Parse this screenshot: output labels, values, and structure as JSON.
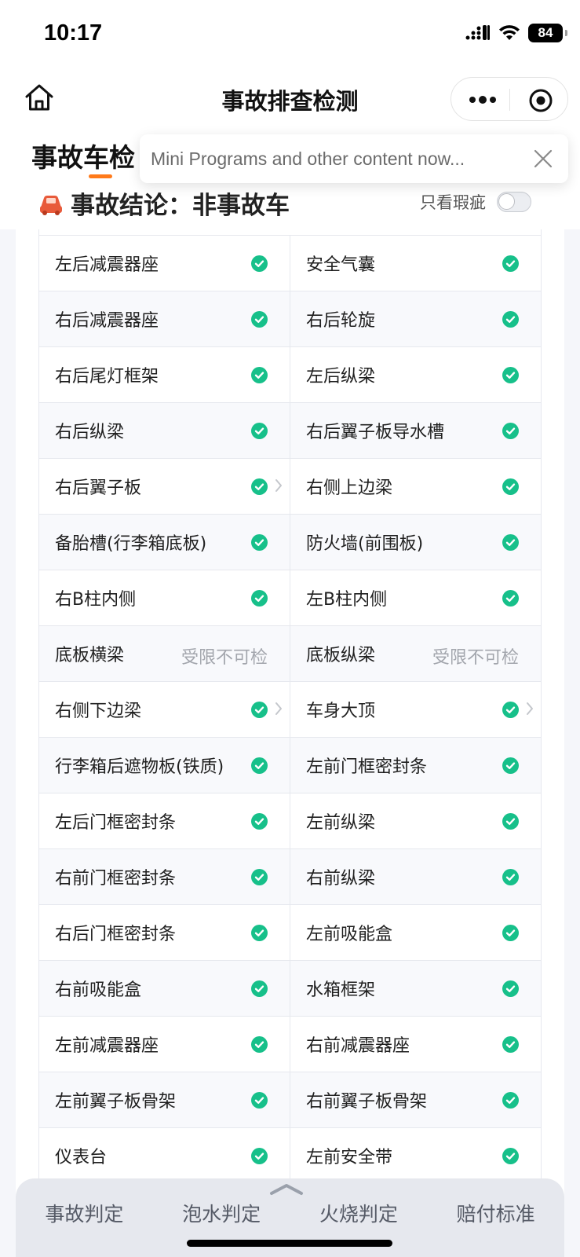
{
  "status_bar": {
    "time": "10:17",
    "battery": "84"
  },
  "nav": {
    "title": "事故排查检测"
  },
  "header": {
    "section_title": "事故车检",
    "conclusion_label": "事故结论：",
    "conclusion_value": "非事故车",
    "filter_label": "只看瑕疵",
    "filter_on": false
  },
  "tooltip": {
    "text": "Mini Programs and other content now..."
  },
  "colors": {
    "accent": "#ff7a1a",
    "ok_green": "#17c08a",
    "conclusion_icon": "#e85a3a"
  },
  "rows": [
    [
      {
        "label": "左后减震器座",
        "status": "ok"
      },
      {
        "label": "安全气囊",
        "status": "ok"
      }
    ],
    [
      {
        "label": "右后减震器座",
        "status": "ok"
      },
      {
        "label": "右后轮旋",
        "status": "ok"
      }
    ],
    [
      {
        "label": "右后尾灯框架",
        "status": "ok"
      },
      {
        "label": "左后纵梁",
        "status": "ok"
      }
    ],
    [
      {
        "label": "右后纵梁",
        "status": "ok"
      },
      {
        "label": "右后翼子板导水槽",
        "status": "ok"
      }
    ],
    [
      {
        "label": "右后翼子板",
        "status": "ok",
        "has_detail": true
      },
      {
        "label": "右侧上边梁",
        "status": "ok"
      }
    ],
    [
      {
        "label": "备胎槽(行李箱底板)",
        "status": "ok"
      },
      {
        "label": "防火墙(前围板)",
        "status": "ok"
      }
    ],
    [
      {
        "label": "右B柱内侧",
        "status": "ok"
      },
      {
        "label": "左B柱内侧",
        "status": "ok"
      }
    ],
    [
      {
        "label": "底板横梁",
        "status": "text",
        "status_text": "受限不可检"
      },
      {
        "label": "底板纵梁",
        "status": "text",
        "status_text": "受限不可检"
      }
    ],
    [
      {
        "label": "右侧下边梁",
        "status": "ok",
        "has_detail": true
      },
      {
        "label": "车身大顶",
        "status": "ok",
        "has_detail": true
      }
    ],
    [
      {
        "label": "行李箱后遮物板(铁质)",
        "status": "ok"
      },
      {
        "label": "左前门框密封条",
        "status": "ok"
      }
    ],
    [
      {
        "label": "左后门框密封条",
        "status": "ok"
      },
      {
        "label": "左前纵梁",
        "status": "ok"
      }
    ],
    [
      {
        "label": "右前门框密封条",
        "status": "ok"
      },
      {
        "label": "右前纵梁",
        "status": "ok"
      }
    ],
    [
      {
        "label": "右后门框密封条",
        "status": "ok"
      },
      {
        "label": "左前吸能盒",
        "status": "ok"
      }
    ],
    [
      {
        "label": "右前吸能盒",
        "status": "ok"
      },
      {
        "label": "水箱框架",
        "status": "ok"
      }
    ],
    [
      {
        "label": "左前减震器座",
        "status": "ok"
      },
      {
        "label": "右前减震器座",
        "status": "ok"
      }
    ],
    [
      {
        "label": "左前翼子板骨架",
        "status": "ok"
      },
      {
        "label": "右前翼子板骨架",
        "status": "ok"
      }
    ],
    [
      {
        "label": "仪表台",
        "status": "ok"
      },
      {
        "label": "左前安全带",
        "status": "ok"
      }
    ]
  ],
  "bottom_tabs": [
    "事故判定",
    "泡水判定",
    "火烧判定",
    "赔付标准"
  ]
}
